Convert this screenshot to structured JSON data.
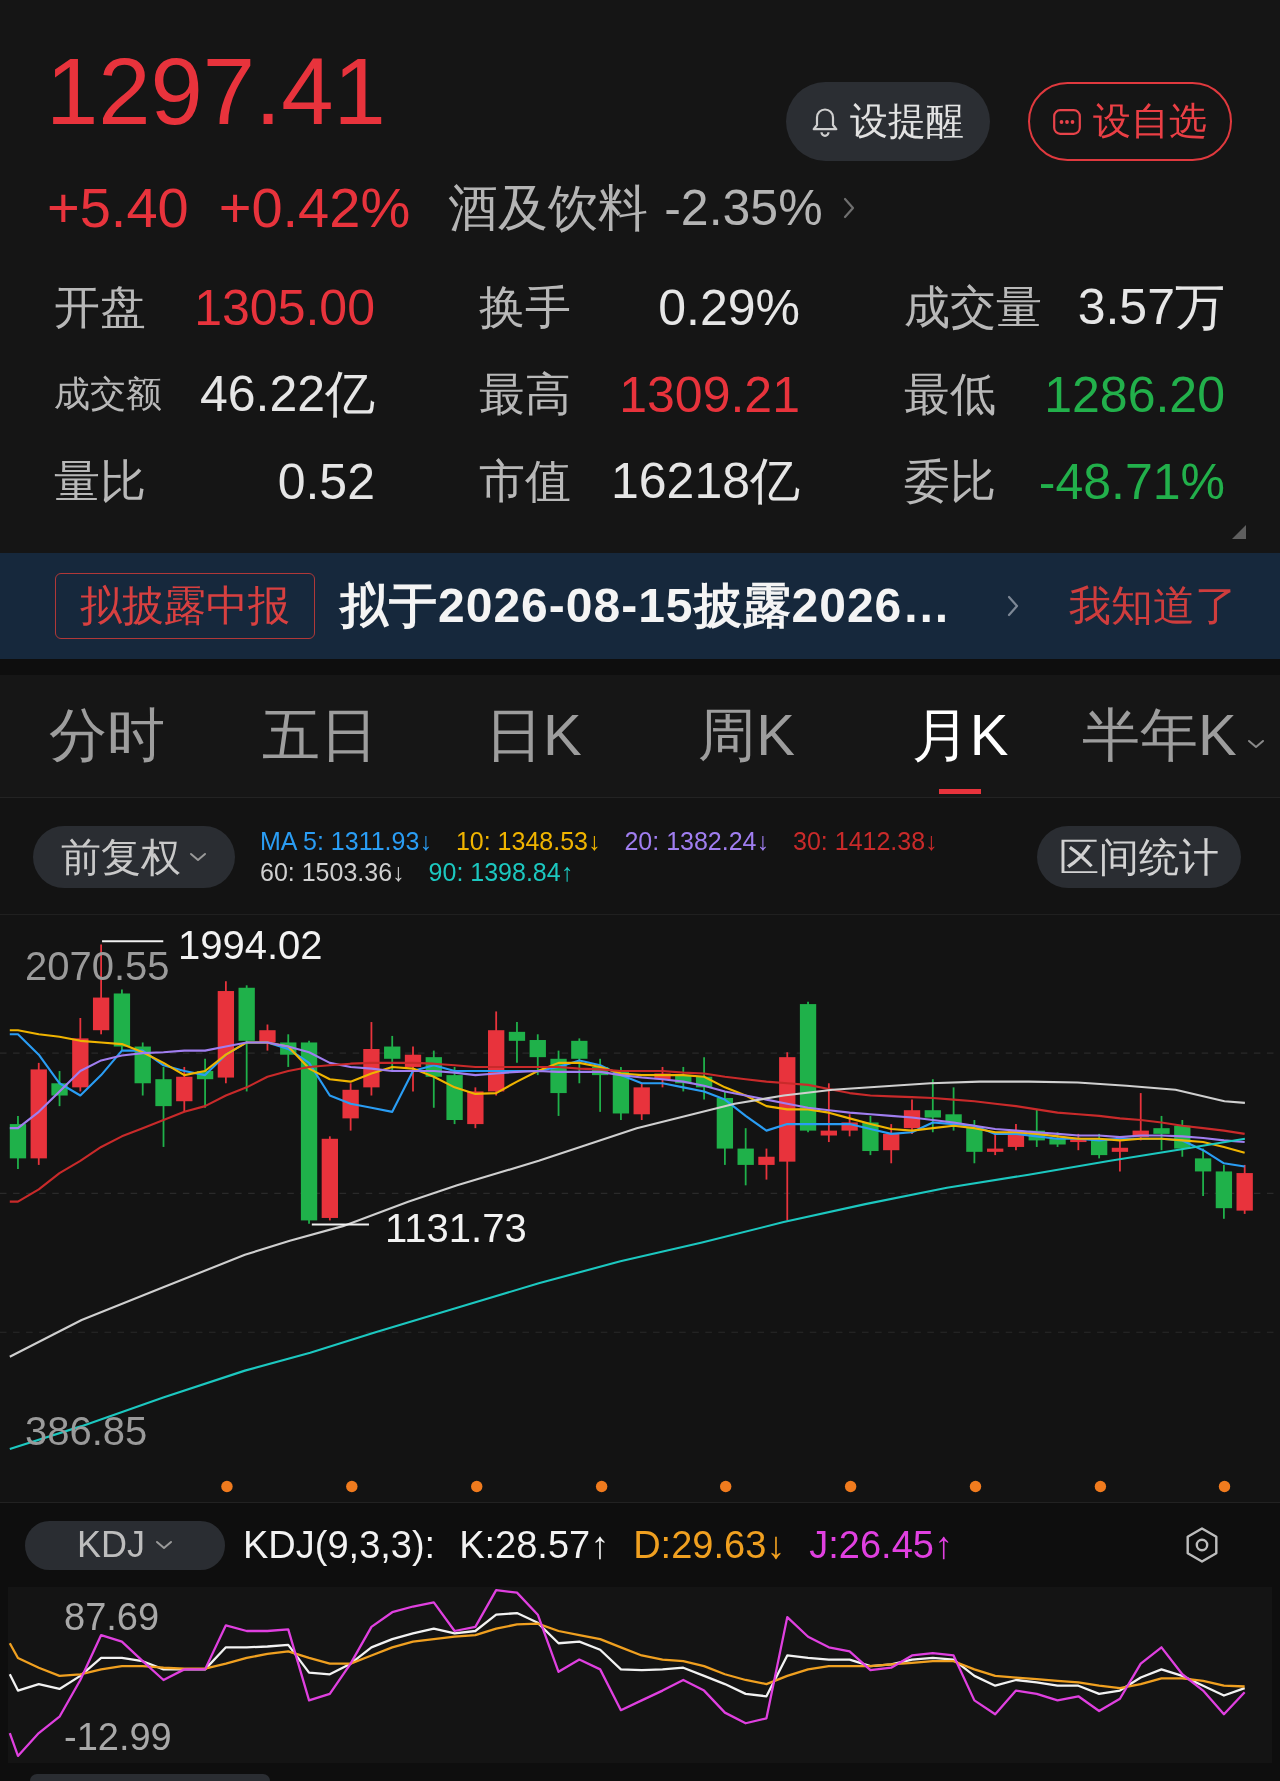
{
  "quote": {
    "price": "1297.41",
    "change": "+5.40",
    "change_percent": "+0.42%",
    "sector": {
      "name": "酒及饮料",
      "change": "-2.35%"
    }
  },
  "actions": [
    {
      "kind": "alert",
      "label": "设提醒"
    },
    {
      "kind": "watchlist",
      "label": "设自选"
    }
  ],
  "stats": [
    {
      "label": "开盘",
      "value": "1305.00",
      "color": "#e8333c"
    },
    {
      "label": "换手",
      "value": "0.29%",
      "color": "#e6e6e6"
    },
    {
      "label": "成交量",
      "value": "3.57万",
      "color": "#e6e6e6"
    },
    {
      "label": "成交额",
      "value": "46.22亿",
      "color": "#e6e6e6"
    },
    {
      "label": "最高",
      "value": "1309.21",
      "color": "#e8333c"
    },
    {
      "label": "最低",
      "value": "1286.20",
      "color": "#22b04b"
    },
    {
      "label": "量比",
      "value": "0.52",
      "color": "#e6e6e6"
    },
    {
      "label": "市值",
      "value": "16218亿",
      "color": "#e6e6e6"
    },
    {
      "label": "委比",
      "value": "-48.71%",
      "color": "#22b04b"
    }
  ],
  "notice": {
    "tag": "拟披露中报",
    "text": "拟于2026-08-15披露2026…",
    "dismiss": "我知道了"
  },
  "period_tabs": [
    {
      "label": "分时",
      "selected": false,
      "has_menu": false
    },
    {
      "label": "五日",
      "selected": false,
      "has_menu": false
    },
    {
      "label": "日K",
      "selected": false,
      "has_menu": false
    },
    {
      "label": "周K",
      "selected": false,
      "has_menu": false
    },
    {
      "label": "月K",
      "selected": true,
      "has_menu": false
    },
    {
      "label": "半年K",
      "selected": false,
      "has_menu": true
    }
  ],
  "price_chart": {
    "adjustment": "前复权",
    "moving_averages": [
      {
        "label": "MA 5: 1311.93↓",
        "color": "#2a9df4"
      },
      {
        "label": "10: 1348.53↓",
        "color": "#f0b400"
      },
      {
        "label": "20: 1382.24↓",
        "color": "#a07ef0"
      },
      {
        "label": "30: 1412.38↓",
        "color": "#c92a2a"
      },
      {
        "label": "60: 1503.36↓",
        "color": "#cfcfcf"
      },
      {
        "label": "90: 1398.84↑",
        "color": "#1cc8c0"
      }
    ],
    "range_stats": "区间统计",
    "axis_max": "2070.55",
    "axis_min": "386.85",
    "high_marker": "1994.02",
    "low_marker": "1131.73"
  },
  "indicator": {
    "selector": "KDJ",
    "title": "KDJ(9,3,3):",
    "values": [
      {
        "label": "K:28.57↑",
        "color": "#f2f2f2"
      },
      {
        "label": "D:29.63↓",
        "color": "#f0a020"
      },
      {
        "label": "J:26.45↑",
        "color": "#e040e0"
      }
    ],
    "axis_max": "87.69",
    "axis_min": "-12.99"
  }
}
